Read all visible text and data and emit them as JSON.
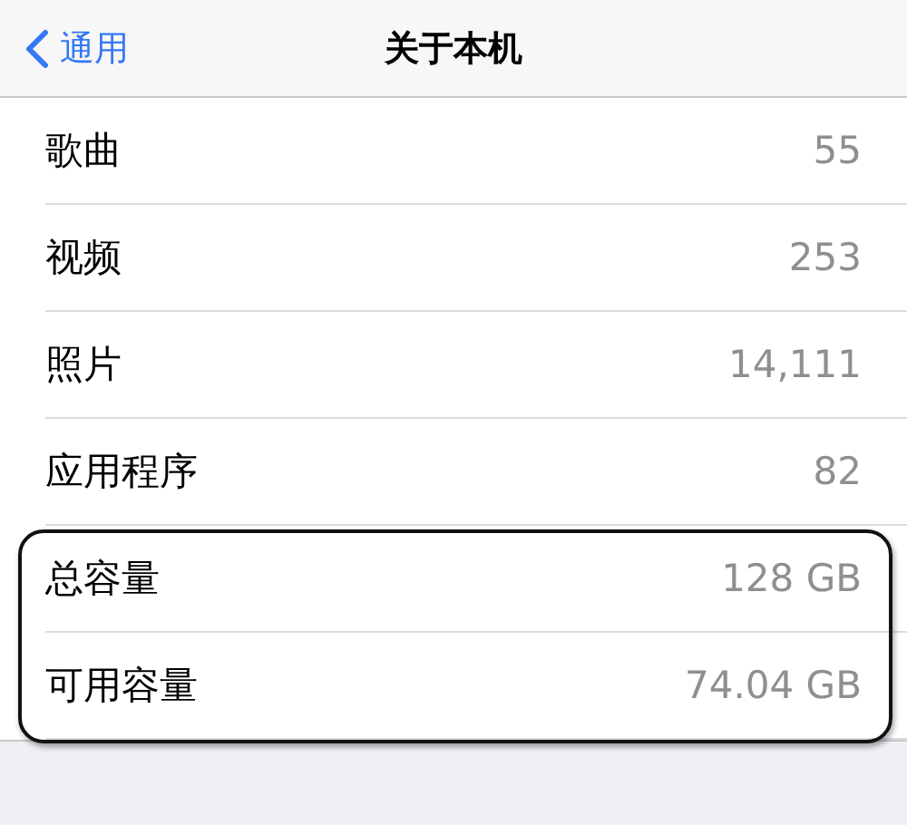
{
  "nav_bar": {
    "back_label": "通用",
    "title": "关于本机"
  },
  "rows": [
    {
      "label": "歌曲",
      "value": "55",
      "highlighted": false
    },
    {
      "label": "视频",
      "value": "253",
      "highlighted": false
    },
    {
      "label": "照片",
      "value": "14,111",
      "highlighted": false
    },
    {
      "label": "应用程序",
      "value": "82",
      "highlighted": false
    },
    {
      "label": "总容量",
      "value": "128 GB",
      "highlighted": true
    },
    {
      "label": "可用容量",
      "value": "74.04 GB",
      "highlighted": true
    }
  ]
}
